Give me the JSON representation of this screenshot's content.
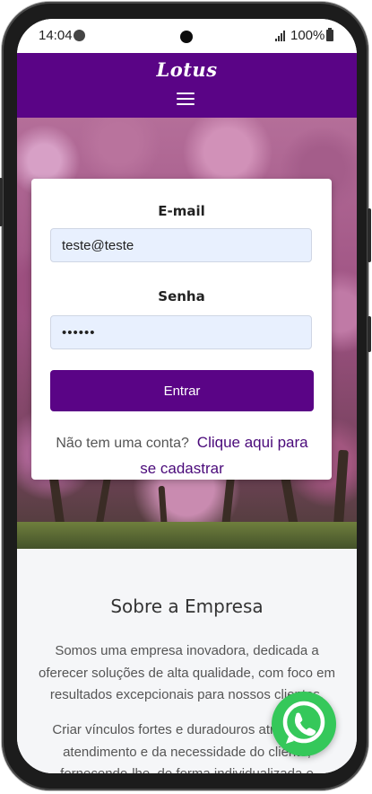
{
  "status_bar": {
    "time": "14:04",
    "battery": "100%"
  },
  "header": {
    "logo": "Lotus"
  },
  "login": {
    "email_label": "E-mail",
    "email_value": "teste@teste",
    "password_label": "Senha",
    "password_value": "••••••",
    "submit_label": "Entrar",
    "signup_question": "Não tem uma conta?",
    "signup_link": "Clique aqui para se cadastrar"
  },
  "about": {
    "title": "Sobre a Empresa",
    "paragraph1": "Somos uma empresa inovadora, dedicada a oferecer soluções de alta qualidade, com foco em resultados excepcionais para nossos clientes.",
    "paragraph2": "Criar vínculos fortes e duradouros através do atendimento e da necessidade do cliente, fornecendo-lhe, de forma individualizada e"
  },
  "colors": {
    "brand_purple": "#5a0486",
    "whatsapp_green": "#35c85a"
  },
  "icons": {
    "menu": "hamburger-menu-icon",
    "whatsapp": "whatsapp-icon"
  }
}
